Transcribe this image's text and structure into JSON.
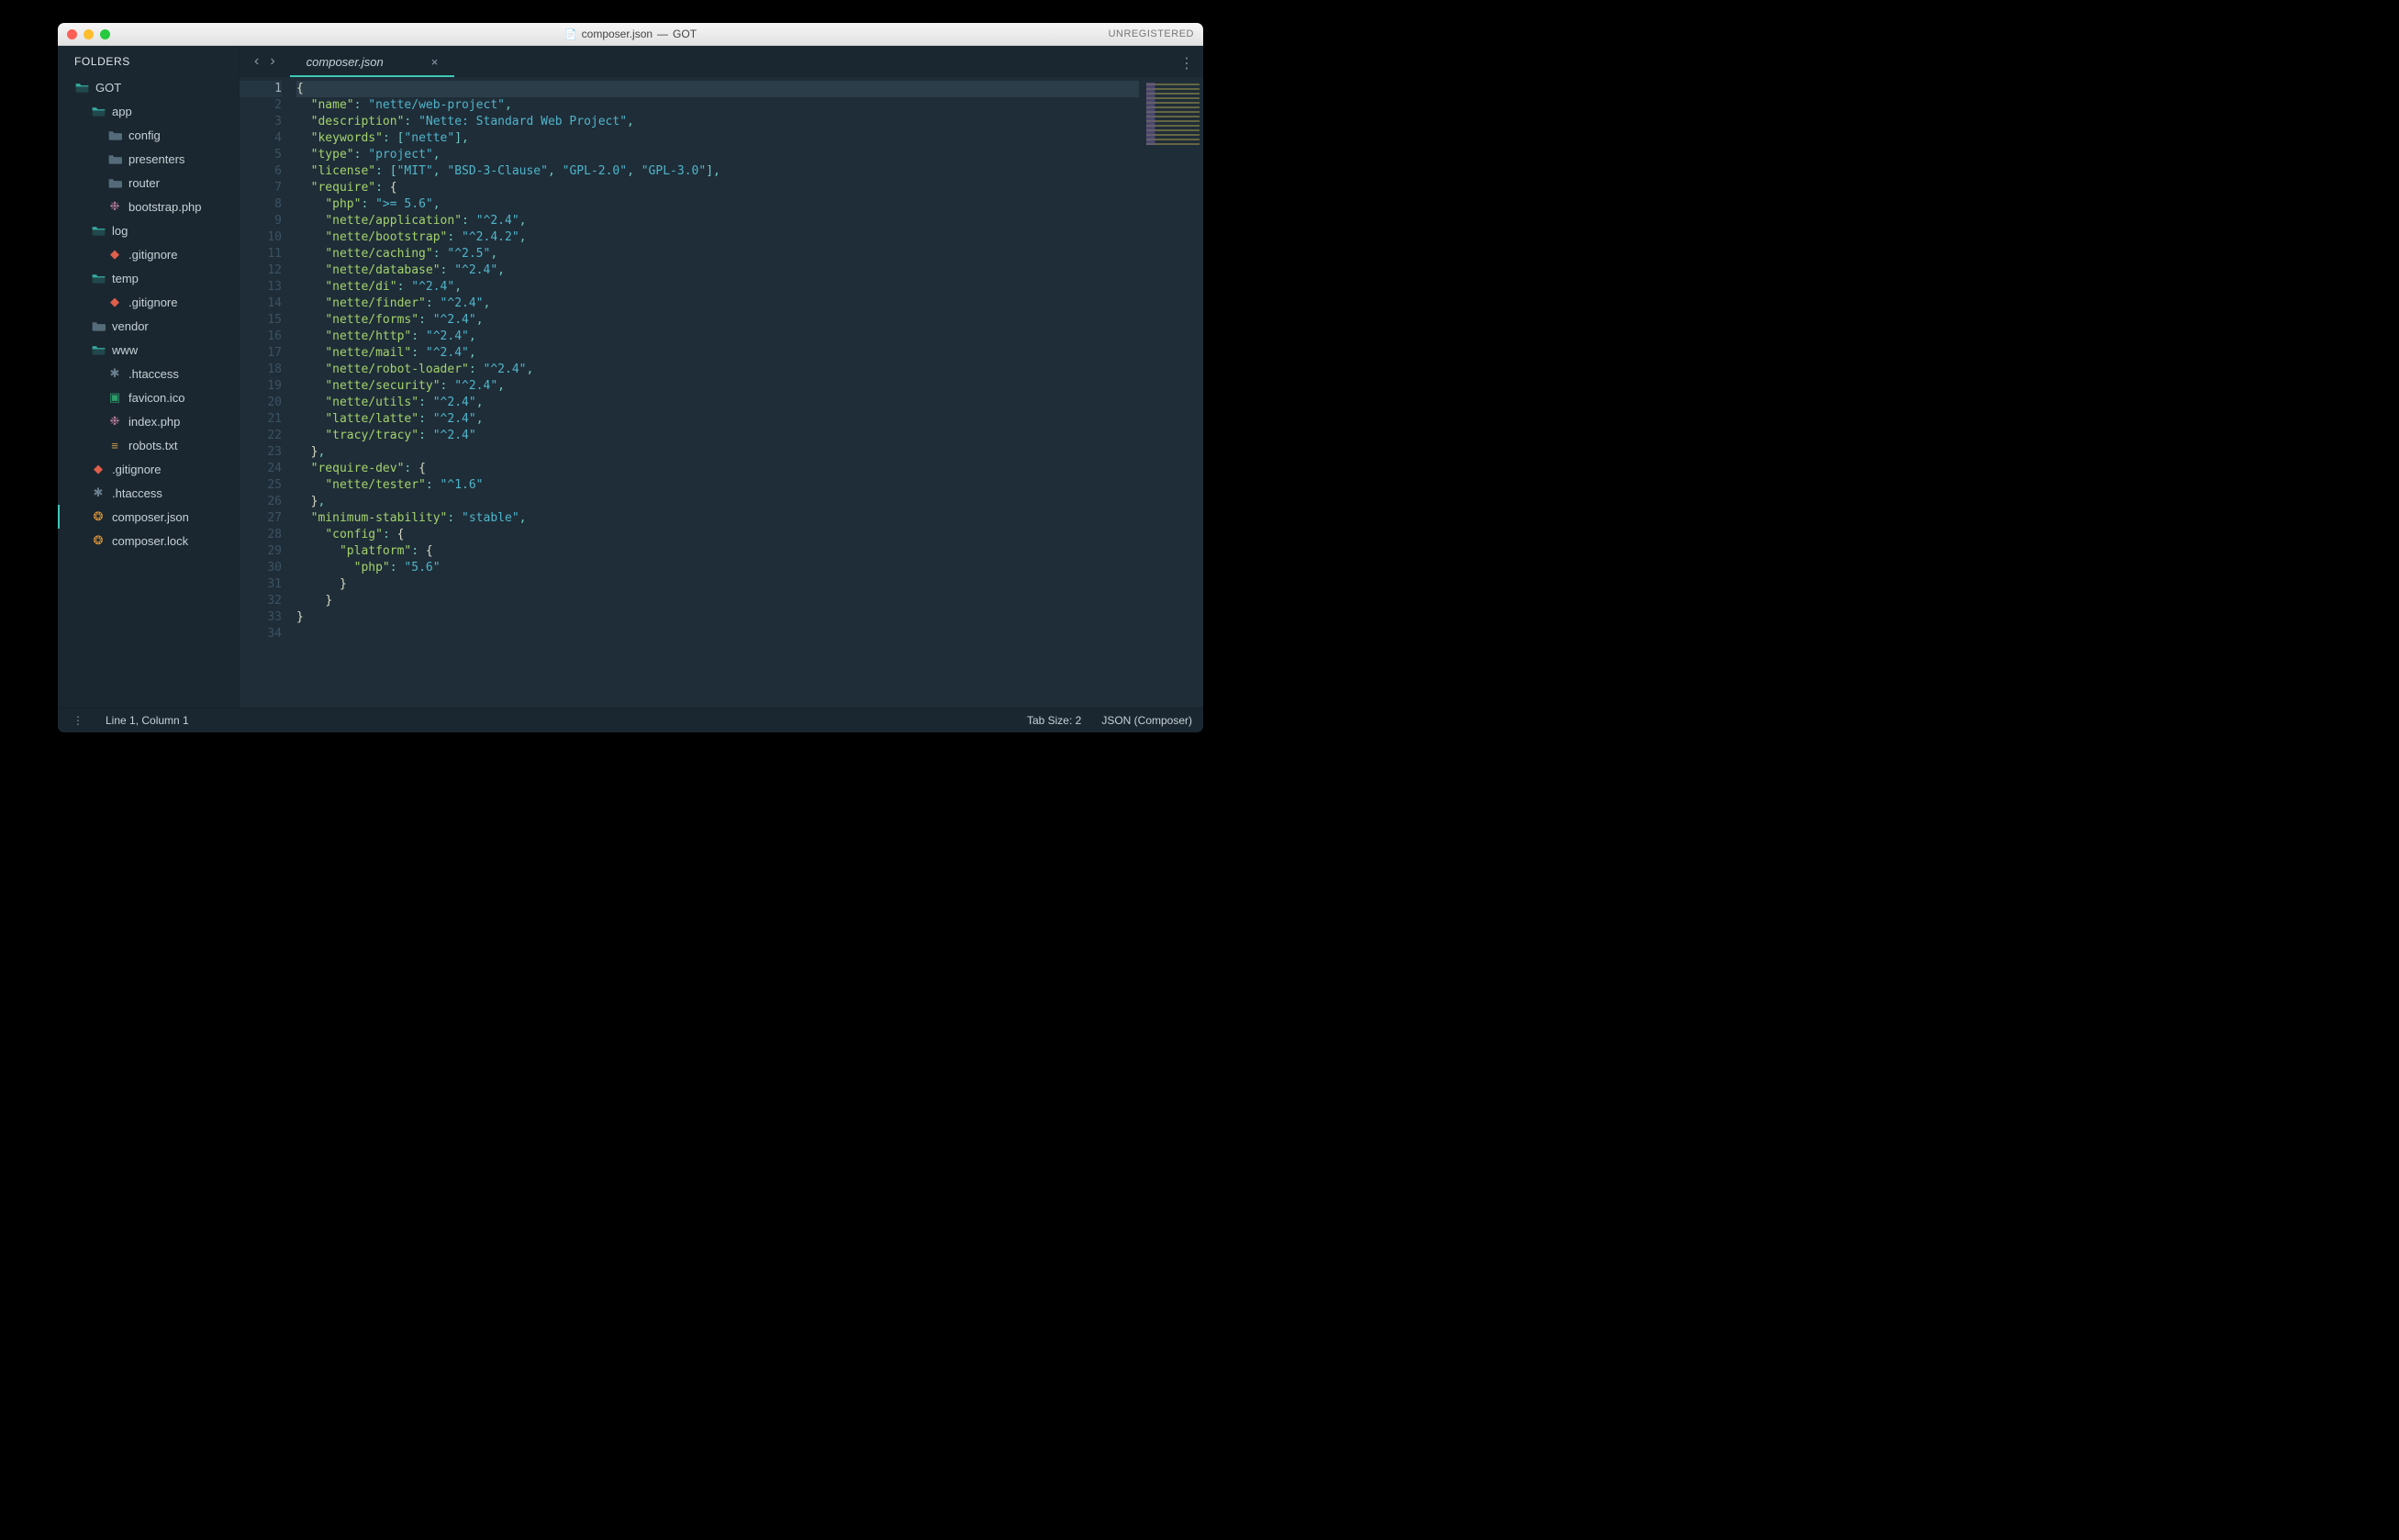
{
  "window": {
    "title_file": "composer.json",
    "title_project": "GOT",
    "title_sep": " — ",
    "unregistered": "UNREGISTERED"
  },
  "sidebar": {
    "header": "FOLDERS",
    "tree": [
      {
        "label": "GOT",
        "depth": 0,
        "type": "folder-open",
        "selected": false
      },
      {
        "label": "app",
        "depth": 1,
        "type": "folder-open",
        "selected": false
      },
      {
        "label": "config",
        "depth": 2,
        "type": "folder-closed",
        "selected": false
      },
      {
        "label": "presenters",
        "depth": 2,
        "type": "folder-closed",
        "selected": false
      },
      {
        "label": "router",
        "depth": 2,
        "type": "folder-closed",
        "selected": false
      },
      {
        "label": "bootstrap.php",
        "depth": 2,
        "type": "php",
        "selected": false
      },
      {
        "label": "log",
        "depth": 1,
        "type": "folder-open",
        "selected": false
      },
      {
        "label": ".gitignore",
        "depth": 2,
        "type": "git",
        "selected": false
      },
      {
        "label": "temp",
        "depth": 1,
        "type": "folder-open",
        "selected": false
      },
      {
        "label": ".gitignore",
        "depth": 2,
        "type": "git",
        "selected": false
      },
      {
        "label": "vendor",
        "depth": 1,
        "type": "folder-closed",
        "selected": false
      },
      {
        "label": "www",
        "depth": 1,
        "type": "folder-open",
        "selected": false
      },
      {
        "label": ".htaccess",
        "depth": 2,
        "type": "generic",
        "selected": false
      },
      {
        "label": "favicon.ico",
        "depth": 2,
        "type": "img",
        "selected": false
      },
      {
        "label": "index.php",
        "depth": 2,
        "type": "php",
        "selected": false
      },
      {
        "label": "robots.txt",
        "depth": 2,
        "type": "txt",
        "selected": false
      },
      {
        "label": ".gitignore",
        "depth": 1,
        "type": "git",
        "selected": false
      },
      {
        "label": ".htaccess",
        "depth": 1,
        "type": "generic",
        "selected": false
      },
      {
        "label": "composer.json",
        "depth": 1,
        "type": "json",
        "selected": true
      },
      {
        "label": "composer.lock",
        "depth": 1,
        "type": "json",
        "selected": false
      }
    ]
  },
  "tabs": {
    "back_glyph": "‹",
    "forward_glyph": "›",
    "items": [
      {
        "label": "composer.json",
        "close": "×",
        "active": true
      }
    ],
    "more_glyph": "⋮"
  },
  "editor": {
    "line_count": 34,
    "current_line": 1,
    "tokens": [
      [
        [
          "b",
          "{"
        ]
      ],
      [
        [
          "ws",
          "  "
        ],
        [
          "k",
          "\"name\""
        ],
        [
          "p",
          ":"
        ],
        [
          "ws",
          " "
        ],
        [
          "s",
          "\"nette/web-project\""
        ],
        [
          "p",
          ","
        ]
      ],
      [
        [
          "ws",
          "  "
        ],
        [
          "k",
          "\"description\""
        ],
        [
          "p",
          ":"
        ],
        [
          "ws",
          " "
        ],
        [
          "s",
          "\"Nette: Standard Web Project\""
        ],
        [
          "p",
          ","
        ]
      ],
      [
        [
          "ws",
          "  "
        ],
        [
          "k",
          "\"keywords\""
        ],
        [
          "p",
          ":"
        ],
        [
          "ws",
          " "
        ],
        [
          "p",
          "["
        ],
        [
          "s",
          "\"nette\""
        ],
        [
          "p",
          "]"
        ],
        [
          "p",
          ","
        ]
      ],
      [
        [
          "ws",
          "  "
        ],
        [
          "k",
          "\"type\""
        ],
        [
          "p",
          ":"
        ],
        [
          "ws",
          " "
        ],
        [
          "s",
          "\"project\""
        ],
        [
          "p",
          ","
        ]
      ],
      [
        [
          "ws",
          "  "
        ],
        [
          "k",
          "\"license\""
        ],
        [
          "p",
          ":"
        ],
        [
          "ws",
          " "
        ],
        [
          "p",
          "["
        ],
        [
          "s",
          "\"MIT\""
        ],
        [
          "p",
          ","
        ],
        [
          "ws",
          " "
        ],
        [
          "s",
          "\"BSD-3-Clause\""
        ],
        [
          "p",
          ","
        ],
        [
          "ws",
          " "
        ],
        [
          "s",
          "\"GPL-2.0\""
        ],
        [
          "p",
          ","
        ],
        [
          "ws",
          " "
        ],
        [
          "s",
          "\"GPL-3.0\""
        ],
        [
          "p",
          "]"
        ],
        [
          "p",
          ","
        ]
      ],
      [
        [
          "ws",
          "  "
        ],
        [
          "k",
          "\"require\""
        ],
        [
          "p",
          ":"
        ],
        [
          "ws",
          " "
        ],
        [
          "b",
          "{"
        ]
      ],
      [
        [
          "ws",
          "    "
        ],
        [
          "k",
          "\"php\""
        ],
        [
          "p",
          ":"
        ],
        [
          "ws",
          " "
        ],
        [
          "s",
          "\">= 5.6\""
        ],
        [
          "p",
          ","
        ]
      ],
      [
        [
          "ws",
          "    "
        ],
        [
          "k",
          "\"nette/application\""
        ],
        [
          "p",
          ":"
        ],
        [
          "ws",
          " "
        ],
        [
          "s",
          "\"^2.4\""
        ],
        [
          "p",
          ","
        ]
      ],
      [
        [
          "ws",
          "    "
        ],
        [
          "k",
          "\"nette/bootstrap\""
        ],
        [
          "p",
          ":"
        ],
        [
          "ws",
          " "
        ],
        [
          "s",
          "\"^2.4.2\""
        ],
        [
          "p",
          ","
        ]
      ],
      [
        [
          "ws",
          "    "
        ],
        [
          "k",
          "\"nette/caching\""
        ],
        [
          "p",
          ":"
        ],
        [
          "ws",
          " "
        ],
        [
          "s",
          "\"^2.5\""
        ],
        [
          "p",
          ","
        ]
      ],
      [
        [
          "ws",
          "    "
        ],
        [
          "k",
          "\"nette/database\""
        ],
        [
          "p",
          ":"
        ],
        [
          "ws",
          " "
        ],
        [
          "s",
          "\"^2.4\""
        ],
        [
          "p",
          ","
        ]
      ],
      [
        [
          "ws",
          "    "
        ],
        [
          "k",
          "\"nette/di\""
        ],
        [
          "p",
          ":"
        ],
        [
          "ws",
          " "
        ],
        [
          "s",
          "\"^2.4\""
        ],
        [
          "p",
          ","
        ]
      ],
      [
        [
          "ws",
          "    "
        ],
        [
          "k",
          "\"nette/finder\""
        ],
        [
          "p",
          ":"
        ],
        [
          "ws",
          " "
        ],
        [
          "s",
          "\"^2.4\""
        ],
        [
          "p",
          ","
        ]
      ],
      [
        [
          "ws",
          "    "
        ],
        [
          "k",
          "\"nette/forms\""
        ],
        [
          "p",
          ":"
        ],
        [
          "ws",
          " "
        ],
        [
          "s",
          "\"^2.4\""
        ],
        [
          "p",
          ","
        ]
      ],
      [
        [
          "ws",
          "    "
        ],
        [
          "k",
          "\"nette/http\""
        ],
        [
          "p",
          ":"
        ],
        [
          "ws",
          " "
        ],
        [
          "s",
          "\"^2.4\""
        ],
        [
          "p",
          ","
        ]
      ],
      [
        [
          "ws",
          "    "
        ],
        [
          "k",
          "\"nette/mail\""
        ],
        [
          "p",
          ":"
        ],
        [
          "ws",
          " "
        ],
        [
          "s",
          "\"^2.4\""
        ],
        [
          "p",
          ","
        ]
      ],
      [
        [
          "ws",
          "    "
        ],
        [
          "k",
          "\"nette/robot-loader\""
        ],
        [
          "p",
          ":"
        ],
        [
          "ws",
          " "
        ],
        [
          "s",
          "\"^2.4\""
        ],
        [
          "p",
          ","
        ]
      ],
      [
        [
          "ws",
          "    "
        ],
        [
          "k",
          "\"nette/security\""
        ],
        [
          "p",
          ":"
        ],
        [
          "ws",
          " "
        ],
        [
          "s",
          "\"^2.4\""
        ],
        [
          "p",
          ","
        ]
      ],
      [
        [
          "ws",
          "    "
        ],
        [
          "k",
          "\"nette/utils\""
        ],
        [
          "p",
          ":"
        ],
        [
          "ws",
          " "
        ],
        [
          "s",
          "\"^2.4\""
        ],
        [
          "p",
          ","
        ]
      ],
      [
        [
          "ws",
          "    "
        ],
        [
          "k",
          "\"latte/latte\""
        ],
        [
          "p",
          ":"
        ],
        [
          "ws",
          " "
        ],
        [
          "s",
          "\"^2.4\""
        ],
        [
          "p",
          ","
        ]
      ],
      [
        [
          "ws",
          "    "
        ],
        [
          "k",
          "\"tracy/tracy\""
        ],
        [
          "p",
          ":"
        ],
        [
          "ws",
          " "
        ],
        [
          "s",
          "\"^2.4\""
        ]
      ],
      [
        [
          "ws",
          "  "
        ],
        [
          "b",
          "}"
        ],
        [
          "p",
          ","
        ]
      ],
      [
        [
          "ws",
          "  "
        ],
        [
          "k",
          "\"require-dev\""
        ],
        [
          "p",
          ":"
        ],
        [
          "ws",
          " "
        ],
        [
          "b",
          "{"
        ]
      ],
      [
        [
          "ws",
          "    "
        ],
        [
          "k",
          "\"nette/tester\""
        ],
        [
          "p",
          ":"
        ],
        [
          "ws",
          " "
        ],
        [
          "s",
          "\"^1.6\""
        ]
      ],
      [
        [
          "ws",
          "  "
        ],
        [
          "b",
          "}"
        ],
        [
          "p",
          ","
        ]
      ],
      [
        [
          "ws",
          "  "
        ],
        [
          "k",
          "\"minimum-stability\""
        ],
        [
          "p",
          ":"
        ],
        [
          "ws",
          " "
        ],
        [
          "s",
          "\"stable\""
        ],
        [
          "p",
          ","
        ]
      ],
      [
        [
          "ws",
          "    "
        ],
        [
          "k",
          "\"config\""
        ],
        [
          "p",
          ":"
        ],
        [
          "ws",
          " "
        ],
        [
          "b",
          "{"
        ]
      ],
      [
        [
          "ws",
          "      "
        ],
        [
          "k",
          "\"platform\""
        ],
        [
          "p",
          ":"
        ],
        [
          "ws",
          " "
        ],
        [
          "b",
          "{"
        ]
      ],
      [
        [
          "ws",
          "        "
        ],
        [
          "k",
          "\"php\""
        ],
        [
          "p",
          ":"
        ],
        [
          "ws",
          " "
        ],
        [
          "s",
          "\"5.6\""
        ]
      ],
      [
        [
          "ws",
          "      "
        ],
        [
          "b",
          "}"
        ]
      ],
      [
        [
          "ws",
          "    "
        ],
        [
          "b",
          "}"
        ]
      ],
      [
        [
          "b",
          "}"
        ]
      ],
      []
    ]
  },
  "statusbar": {
    "left": "Line 1, Column 1",
    "tab_size": "Tab Size: 2",
    "syntax": "JSON (Composer)"
  },
  "icons": {
    "folder_open": "▢",
    "folder_closed": "▢"
  }
}
